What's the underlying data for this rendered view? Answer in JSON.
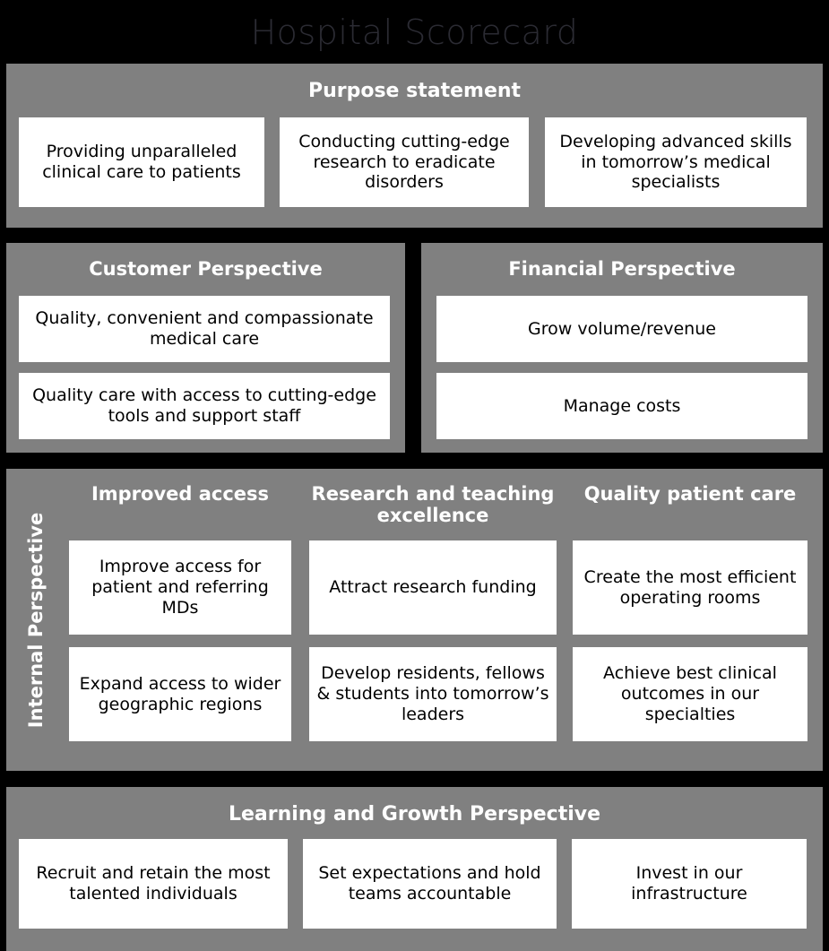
{
  "title": "Hospital Scorecard",
  "colors": {
    "background": "#000000",
    "panel": "#808080",
    "card": "#ffffff",
    "card_text": "#000000",
    "heading_text": "#ffffff",
    "title_text": "#2b2b33"
  },
  "purpose": {
    "heading": "Purpose statement",
    "cards": [
      "Providing unparalleled clinical care to patients",
      "Conducting cutting-edge research to eradicate disorders",
      "Developing advanced skills in tomorrow’s medical specialists"
    ]
  },
  "customer": {
    "heading": "Customer Perspective",
    "cards": [
      "Quality, convenient and compassionate medical care",
      "Quality care with access to cutting-edge tools and support staff"
    ]
  },
  "financial": {
    "heading": "Financial Perspective",
    "cards": [
      "Grow volume/revenue",
      "Manage costs"
    ]
  },
  "internal": {
    "label": "Internal Perspective",
    "columns": [
      {
        "heading": "Improved access",
        "cards": [
          "Improve access for patient and referring MDs",
          "Expand access to wider geographic regions"
        ]
      },
      {
        "heading": "Research and teaching excellence",
        "cards": [
          "Attract research funding",
          "Develop residents, fellows & students into tomorrow’s leaders"
        ]
      },
      {
        "heading": "Quality patient care",
        "cards": [
          "Create the most efficient operating rooms",
          "Achieve best clinical outcomes in our specialties"
        ]
      }
    ]
  },
  "learning": {
    "heading": "Learning and Growth Perspective",
    "cards": [
      "Recruit and retain the most talented individuals",
      "Set expectations and hold teams accountable",
      "Invest in our infrastructure"
    ]
  }
}
